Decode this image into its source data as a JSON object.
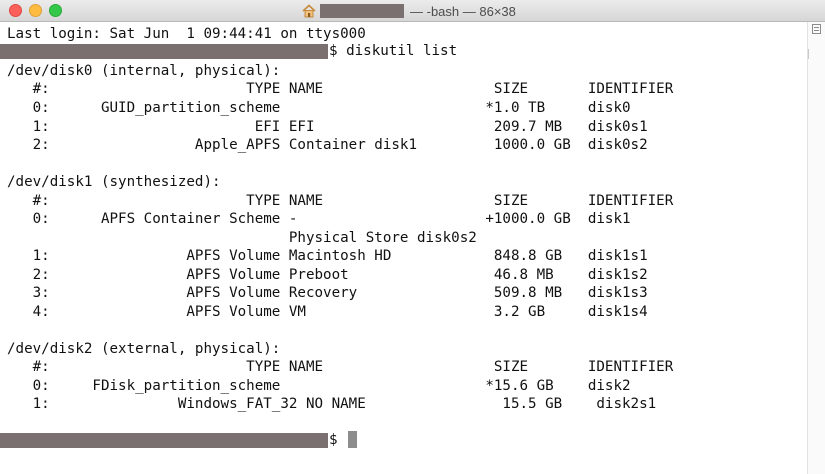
{
  "window": {
    "title": "— -bash — 86×38",
    "icons": [
      "home-icon"
    ],
    "colors": {
      "close": "#fc605b",
      "minimize": "#fdbc40",
      "maximize": "#34c84a",
      "redaction": "#7a7070"
    }
  },
  "terminal": {
    "lines": [
      "Last login: Sat Jun  1 09:44:41 on ttys000",
      "$ diskutil list",
      "/dev/disk0 (internal, physical):",
      "   #:                       TYPE NAME                    SIZE       IDENTIFIER",
      "   0:      GUID_partition_scheme                        *1.0 TB     disk0",
      "   1:                        EFI EFI                     209.7 MB   disk0s1",
      "   2:                 Apple_APFS Container disk1         1000.0 GB  disk0s2",
      "",
      "/dev/disk1 (synthesized):",
      "   #:                       TYPE NAME                    SIZE       IDENTIFIER",
      "   0:      APFS Container Scheme -                      +1000.0 GB  disk1",
      "                                 Physical Store disk0s2",
      "   1:                APFS Volume Macintosh HD            848.8 GB   disk1s1",
      "   2:                APFS Volume Preboot                 46.8 MB    disk1s2",
      "   3:                APFS Volume Recovery                509.8 MB   disk1s3",
      "   4:                APFS Volume VM                      3.2 GB     disk1s4",
      "",
      "/dev/disk2 (external, physical):",
      "   #:                       TYPE NAME                    SIZE       IDENTIFIER",
      "   0:     FDisk_partition_scheme                        *15.6 GB    disk2",
      "   1:               Windows_FAT_32 NO NAME                15.5 GB    disk2s1",
      "",
      "$ "
    ]
  }
}
